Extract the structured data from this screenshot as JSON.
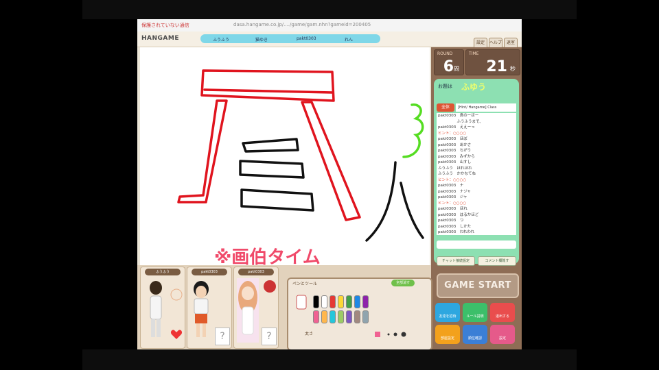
{
  "browser": {
    "warning": "保護されていない通信",
    "url": "dasa.hangame.co.jp/..../game/gam.nhn?gameid=200405"
  },
  "topbar": {
    "logo": "HANGAME",
    "players": [
      "ふうふう",
      "猫ゆき",
      "pakt0303",
      "れん"
    ],
    "buttons": [
      "設定",
      "ヘルプ",
      "退室"
    ]
  },
  "canvas": {
    "caption": "※画伯タイム"
  },
  "stats": {
    "round_label": "ROUND",
    "round_value": "6",
    "round_unit": "問",
    "time_label": "TIME",
    "time_value": "21",
    "time_unit": "秒"
  },
  "chat": {
    "theme_label": "お題は",
    "theme_value": "ふゆう",
    "tab_all": "全体",
    "tab_mode": "[Hint/ Hangame] Class",
    "log": [
      "pakt0303　鳥のーほー",
      "　　　　　ふうふうまで、",
      "pakt0303　ええーっ",
      "ヒント：○○○○",
      "pakt0303　ほぼ",
      "pakt0303　あかさ",
      "pakt0303　ちがう",
      "pakt0303　みずから",
      "pakt0303　山すし",
      "ふうふう　ほれほれ",
      "ふうふう　かかなてね",
      "ヒント：○○○○",
      "pakt0303　ナ",
      "pakt0303　ナジャ",
      "pakt0303　ジャ",
      "ヒント：○○○○",
      "pakt0303　ほれ",
      "pakt0303　はるかほど",
      "pakt0303　つ",
      "pakt0303　しかた",
      "pakt0303　われわれ"
    ],
    "btn_left": "チャット接続設定",
    "btn_right": "コメント欄隠す"
  },
  "game_start": "GAME START",
  "menu_buttons": [
    "友達を招待",
    "ルール説明",
    "退出する",
    "部屋設定",
    "順位確認",
    "設定"
  ],
  "player_slots": [
    {
      "name": "ふうふう"
    },
    {
      "name": "pakt0303"
    },
    {
      "name": "pakt0303"
    }
  ],
  "palette": {
    "title": "ペンとツール",
    "clear": "全部消す",
    "label": "太さ",
    "pen_colors": [
      "#000000",
      "#ffffff",
      "#e53935",
      "#fdd835",
      "#43a047",
      "#1e88e5",
      "#8e24aa",
      "#f06292",
      "#ffb74d",
      "#26c6da",
      "#9ccc65",
      "#7e57c2",
      "#a1887f",
      "#90a4ae"
    ]
  }
}
